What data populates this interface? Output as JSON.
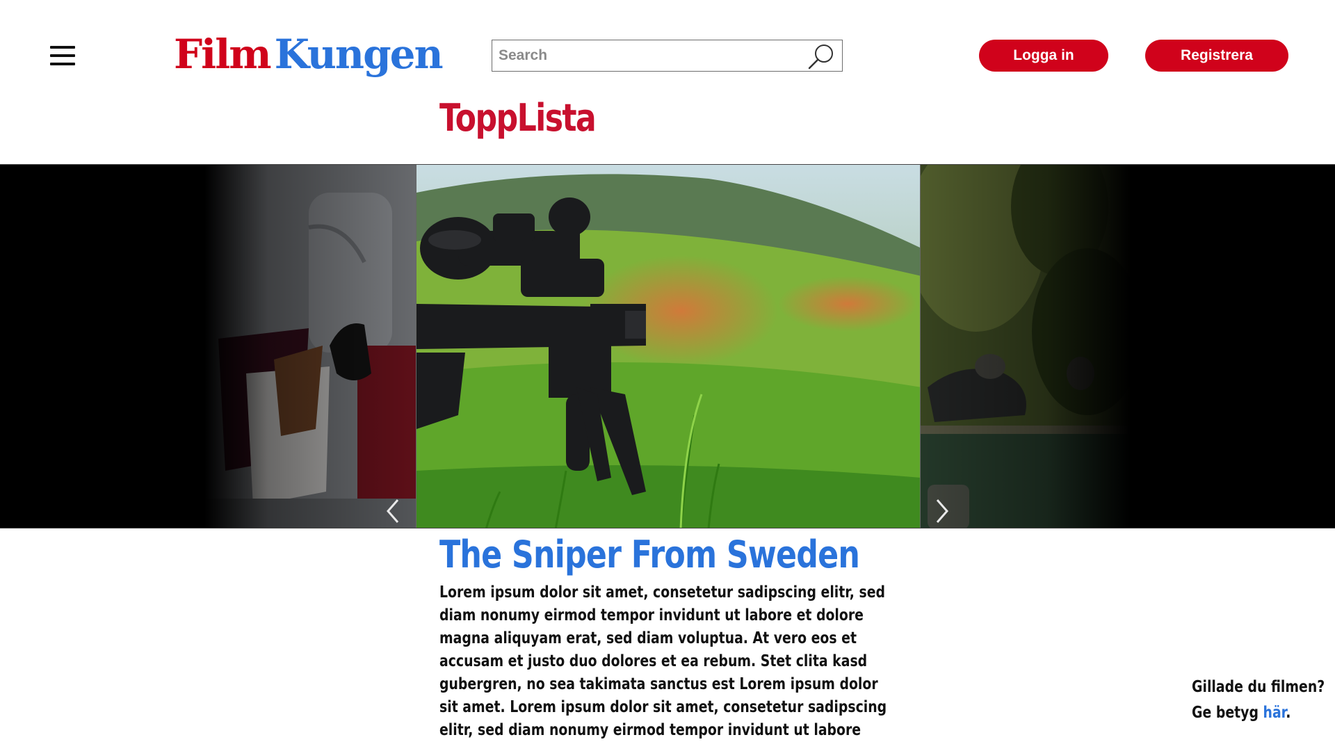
{
  "header": {
    "menu_icon": "hamburger-menu-icon",
    "logo_part1": "Film",
    "logo_part2": "Kungen",
    "search_placeholder": "Search",
    "search_icon": "magnifier-icon",
    "login_label": "Logga in",
    "register_label": "Registrera"
  },
  "section": {
    "title": "ToppLista"
  },
  "carousel": {
    "prev_icon": "chevron-left-icon",
    "next_icon": "chevron-right-icon"
  },
  "movie": {
    "title": "The Sniper From Sweden",
    "description": "Lorem ipsum dolor sit amet, consetetur sadipscing elitr, sed diam nonumy eirmod tempor invidunt ut labore et dolore magna aliquyam erat, sed diam voluptua. At vero eos et accusam et justo duo dolores et ea rebum. Stet clita kasd gubergren, no sea takimata sanctus est Lorem ipsum dolor sit amet. Lorem ipsum dolor sit amet, consetetur sadipscing elitr, sed diam nonumy eirmod tempor invidunt ut labore"
  },
  "rating_prompt": {
    "line1": "Gillade du filmen?",
    "line2_prefix": "Ge betyg ",
    "link_text": "här",
    "line2_suffix": "."
  },
  "colors": {
    "brand_red": "#d0021b",
    "brand_blue": "#2a73db",
    "title_red": "#c8102e"
  }
}
